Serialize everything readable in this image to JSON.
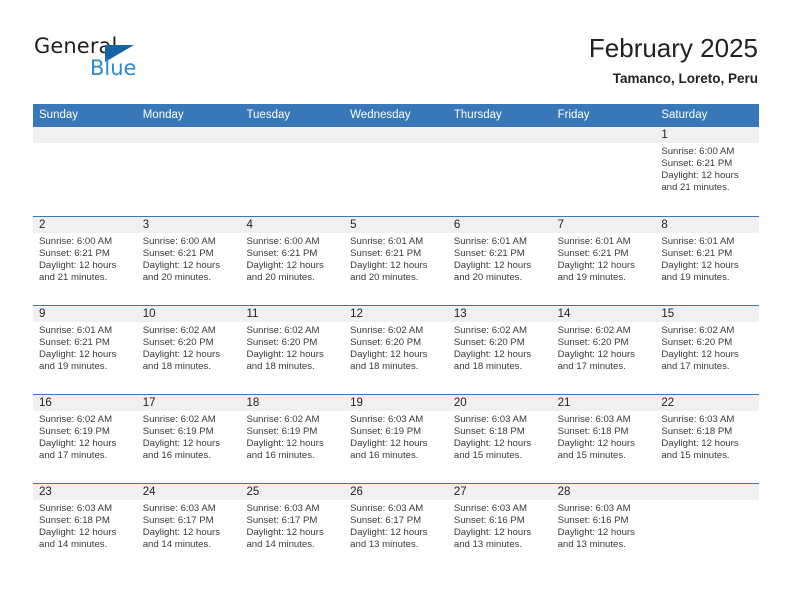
{
  "brand": {
    "name_part1": "General",
    "name_part2": "Blue",
    "triangle_color": "#1464a5",
    "blue_color": "#2e8bd0"
  },
  "header": {
    "title": "February 2025",
    "location": "Tamanco, Loreto, Peru"
  },
  "theme": {
    "header_blue": "#3877b8",
    "day_number_bg": "#f0f0f0",
    "text": "#222222"
  },
  "calendar": {
    "weekdays": [
      "Sunday",
      "Monday",
      "Tuesday",
      "Wednesday",
      "Thursday",
      "Friday",
      "Saturday"
    ],
    "weeks": [
      [
        {
          "day": "",
          "sunrise": "",
          "sunset": "",
          "daylight": "",
          "daylight_cont": ""
        },
        {
          "day": "",
          "sunrise": "",
          "sunset": "",
          "daylight": "",
          "daylight_cont": ""
        },
        {
          "day": "",
          "sunrise": "",
          "sunset": "",
          "daylight": "",
          "daylight_cont": ""
        },
        {
          "day": "",
          "sunrise": "",
          "sunset": "",
          "daylight": "",
          "daylight_cont": ""
        },
        {
          "day": "",
          "sunrise": "",
          "sunset": "",
          "daylight": "",
          "daylight_cont": ""
        },
        {
          "day": "",
          "sunrise": "",
          "sunset": "",
          "daylight": "",
          "daylight_cont": ""
        },
        {
          "day": "1",
          "sunrise": "Sunrise: 6:00 AM",
          "sunset": "Sunset: 6:21 PM",
          "daylight": "Daylight: 12 hours",
          "daylight_cont": "and 21 minutes."
        }
      ],
      [
        {
          "day": "2",
          "sunrise": "Sunrise: 6:00 AM",
          "sunset": "Sunset: 6:21 PM",
          "daylight": "Daylight: 12 hours",
          "daylight_cont": "and 21 minutes."
        },
        {
          "day": "3",
          "sunrise": "Sunrise: 6:00 AM",
          "sunset": "Sunset: 6:21 PM",
          "daylight": "Daylight: 12 hours",
          "daylight_cont": "and 20 minutes."
        },
        {
          "day": "4",
          "sunrise": "Sunrise: 6:00 AM",
          "sunset": "Sunset: 6:21 PM",
          "daylight": "Daylight: 12 hours",
          "daylight_cont": "and 20 minutes."
        },
        {
          "day": "5",
          "sunrise": "Sunrise: 6:01 AM",
          "sunset": "Sunset: 6:21 PM",
          "daylight": "Daylight: 12 hours",
          "daylight_cont": "and 20 minutes."
        },
        {
          "day": "6",
          "sunrise": "Sunrise: 6:01 AM",
          "sunset": "Sunset: 6:21 PM",
          "daylight": "Daylight: 12 hours",
          "daylight_cont": "and 20 minutes."
        },
        {
          "day": "7",
          "sunrise": "Sunrise: 6:01 AM",
          "sunset": "Sunset: 6:21 PM",
          "daylight": "Daylight: 12 hours",
          "daylight_cont": "and 19 minutes."
        },
        {
          "day": "8",
          "sunrise": "Sunrise: 6:01 AM",
          "sunset": "Sunset: 6:21 PM",
          "daylight": "Daylight: 12 hours",
          "daylight_cont": "and 19 minutes."
        }
      ],
      [
        {
          "day": "9",
          "sunrise": "Sunrise: 6:01 AM",
          "sunset": "Sunset: 6:21 PM",
          "daylight": "Daylight: 12 hours",
          "daylight_cont": "and 19 minutes."
        },
        {
          "day": "10",
          "sunrise": "Sunrise: 6:02 AM",
          "sunset": "Sunset: 6:20 PM",
          "daylight": "Daylight: 12 hours",
          "daylight_cont": "and 18 minutes."
        },
        {
          "day": "11",
          "sunrise": "Sunrise: 6:02 AM",
          "sunset": "Sunset: 6:20 PM",
          "daylight": "Daylight: 12 hours",
          "daylight_cont": "and 18 minutes."
        },
        {
          "day": "12",
          "sunrise": "Sunrise: 6:02 AM",
          "sunset": "Sunset: 6:20 PM",
          "daylight": "Daylight: 12 hours",
          "daylight_cont": "and 18 minutes."
        },
        {
          "day": "13",
          "sunrise": "Sunrise: 6:02 AM",
          "sunset": "Sunset: 6:20 PM",
          "daylight": "Daylight: 12 hours",
          "daylight_cont": "and 18 minutes."
        },
        {
          "day": "14",
          "sunrise": "Sunrise: 6:02 AM",
          "sunset": "Sunset: 6:20 PM",
          "daylight": "Daylight: 12 hours",
          "daylight_cont": "and 17 minutes."
        },
        {
          "day": "15",
          "sunrise": "Sunrise: 6:02 AM",
          "sunset": "Sunset: 6:20 PM",
          "daylight": "Daylight: 12 hours",
          "daylight_cont": "and 17 minutes."
        }
      ],
      [
        {
          "day": "16",
          "sunrise": "Sunrise: 6:02 AM",
          "sunset": "Sunset: 6:19 PM",
          "daylight": "Daylight: 12 hours",
          "daylight_cont": "and 17 minutes."
        },
        {
          "day": "17",
          "sunrise": "Sunrise: 6:02 AM",
          "sunset": "Sunset: 6:19 PM",
          "daylight": "Daylight: 12 hours",
          "daylight_cont": "and 16 minutes."
        },
        {
          "day": "18",
          "sunrise": "Sunrise: 6:02 AM",
          "sunset": "Sunset: 6:19 PM",
          "daylight": "Daylight: 12 hours",
          "daylight_cont": "and 16 minutes."
        },
        {
          "day": "19",
          "sunrise": "Sunrise: 6:03 AM",
          "sunset": "Sunset: 6:19 PM",
          "daylight": "Daylight: 12 hours",
          "daylight_cont": "and 16 minutes."
        },
        {
          "day": "20",
          "sunrise": "Sunrise: 6:03 AM",
          "sunset": "Sunset: 6:18 PM",
          "daylight": "Daylight: 12 hours",
          "daylight_cont": "and 15 minutes."
        },
        {
          "day": "21",
          "sunrise": "Sunrise: 6:03 AM",
          "sunset": "Sunset: 6:18 PM",
          "daylight": "Daylight: 12 hours",
          "daylight_cont": "and 15 minutes."
        },
        {
          "day": "22",
          "sunrise": "Sunrise: 6:03 AM",
          "sunset": "Sunset: 6:18 PM",
          "daylight": "Daylight: 12 hours",
          "daylight_cont": "and 15 minutes."
        }
      ],
      [
        {
          "day": "23",
          "sunrise": "Sunrise: 6:03 AM",
          "sunset": "Sunset: 6:18 PM",
          "daylight": "Daylight: 12 hours",
          "daylight_cont": "and 14 minutes."
        },
        {
          "day": "24",
          "sunrise": "Sunrise: 6:03 AM",
          "sunset": "Sunset: 6:17 PM",
          "daylight": "Daylight: 12 hours",
          "daylight_cont": "and 14 minutes."
        },
        {
          "day": "25",
          "sunrise": "Sunrise: 6:03 AM",
          "sunset": "Sunset: 6:17 PM",
          "daylight": "Daylight: 12 hours",
          "daylight_cont": "and 14 minutes."
        },
        {
          "day": "26",
          "sunrise": "Sunrise: 6:03 AM",
          "sunset": "Sunset: 6:17 PM",
          "daylight": "Daylight: 12 hours",
          "daylight_cont": "and 13 minutes."
        },
        {
          "day": "27",
          "sunrise": "Sunrise: 6:03 AM",
          "sunset": "Sunset: 6:16 PM",
          "daylight": "Daylight: 12 hours",
          "daylight_cont": "and 13 minutes."
        },
        {
          "day": "28",
          "sunrise": "Sunrise: 6:03 AM",
          "sunset": "Sunset: 6:16 PM",
          "daylight": "Daylight: 12 hours",
          "daylight_cont": "and 13 minutes."
        },
        {
          "day": "",
          "sunrise": "",
          "sunset": "",
          "daylight": "",
          "daylight_cont": ""
        }
      ]
    ]
  }
}
